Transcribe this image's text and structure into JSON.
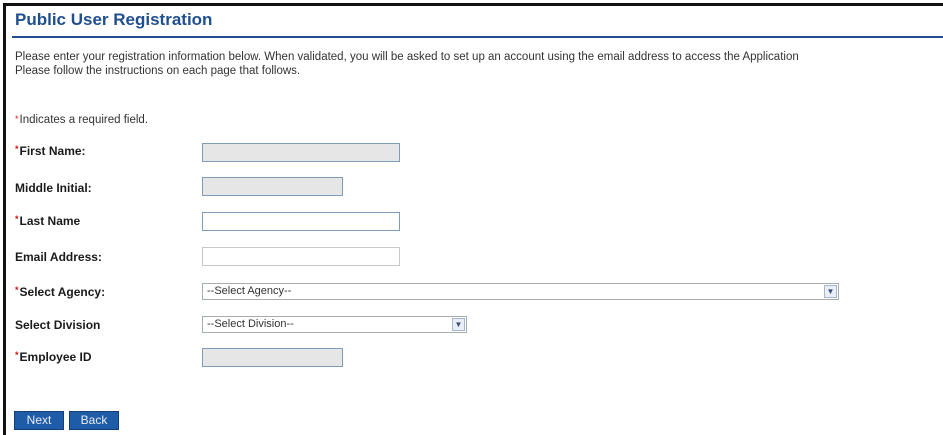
{
  "page": {
    "title": "Public User Registration",
    "intro_line1": "Please enter your registration information below. When validated, you will be asked to set up an account using the email address to access the Application",
    "intro_line2": "Please follow the instructions on each page that follows.",
    "required_marker": "*",
    "required_note": "Indicates a required field."
  },
  "form": {
    "first_name_label": "First Name:",
    "first_name_value": "",
    "middle_initial_label": "Middle Initial:",
    "middle_initial_value": "",
    "last_name_label": "Last Name",
    "last_name_value": "",
    "email_label": "Email Address:",
    "email_value": "",
    "agency_label": "Select Agency:",
    "agency_selected": "--Select Agency--",
    "division_label": "Select Division",
    "division_selected": "--Select Division--",
    "employee_id_label": "Employee ID",
    "employee_id_value": ""
  },
  "buttons": {
    "next": "Next",
    "back": "Back"
  },
  "colors": {
    "title": "#1f4f8f",
    "required_star": "#dd1111",
    "button_bg": "#1f5ca8",
    "readonly_field_bg": "#e6e6e6"
  },
  "icons": {
    "dropdown_arrow": "chevron-down-icon"
  }
}
